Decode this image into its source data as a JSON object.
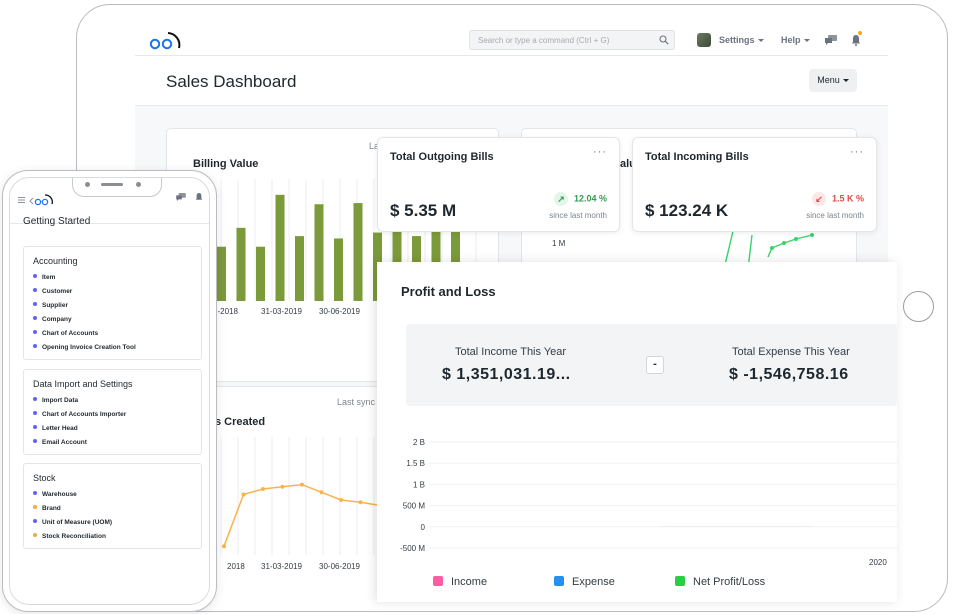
{
  "app": {
    "search_placeholder": "Search or type a command (Ctrl + G)",
    "settings_label": "Settings",
    "help_label": "Help",
    "page_title": "Sales Dashboard",
    "menu_label": "Menu"
  },
  "billing_card": {
    "title": "Billing Value",
    "sync_text": "La",
    "x_ticks": [
      "2-2018",
      "31-03-2019",
      "30-06-2019"
    ],
    "bar_color": "#7b9a3a",
    "values": [
      0.46,
      0.62,
      0.46,
      0.9,
      0.55,
      0.82,
      0.53,
      0.83,
      0.58,
      0.72,
      0.55,
      0.7,
      0.78
    ]
  },
  "second_card": {
    "title_fragment": "alu",
    "y_tick": "1 M"
  },
  "created_card": {
    "title_fragment": "s Created",
    "sync_text": "Last sync",
    "x_ticks": [
      "2018",
      "31-03-2019",
      "30-06-2019"
    ],
    "line_color": "#f8b44b",
    "values": [
      0.08,
      0.55,
      0.6,
      0.62,
      0.64,
      0.57,
      0.5,
      0.48,
      0.45,
      0.2,
      0.48
    ]
  },
  "outgoing": {
    "title": "Total Outgoing Bills",
    "value": "$ 5.35 M",
    "change": "12.04 %",
    "since": "since last month",
    "trend_color": "#2e9e4f"
  },
  "incoming": {
    "title": "Total Incoming Bills",
    "value": "$ 123.24 K",
    "change": "1.5 K %",
    "since": "since last month",
    "trend_color": "#e24c4c"
  },
  "profit_loss": {
    "title": "Profit and Loss",
    "income_label": "Total Income This Year",
    "income_value": "$ 1,351,031.19...",
    "expense_label": "Total Expense This Year",
    "expense_value": "$ -1,546,758.16",
    "operator": "-"
  },
  "chart_data": {
    "type": "bar",
    "categories": [
      "2020"
    ],
    "series": [
      {
        "name": "Income",
        "values": [
          1351031.19
        ],
        "color": "#ff5ba0"
      },
      {
        "name": "Expense",
        "values": [
          null
        ],
        "color": "#2490ef"
      },
      {
        "name": "Net Profit/Loss",
        "values": [
          null
        ],
        "color": "#29cd42"
      }
    ],
    "y_ticks": [
      "2 B",
      "1.5 B",
      "1 B",
      "500 M",
      "0",
      "-500 M"
    ],
    "ylim": [
      -500000000,
      2000000000
    ]
  },
  "phone": {
    "title": "Getting Started",
    "sections": [
      {
        "title": "Accounting",
        "items": [
          {
            "label": "Item",
            "dot": "#5e64ff"
          },
          {
            "label": "Customer",
            "dot": "#5e64ff"
          },
          {
            "label": "Supplier",
            "dot": "#5e64ff"
          },
          {
            "label": "Company",
            "dot": "#5e64ff"
          },
          {
            "label": "Chart of Accounts",
            "dot": "#5e64ff"
          },
          {
            "label": "Opening Invoice Creation Tool",
            "dot": "#5e64ff"
          }
        ]
      },
      {
        "title": "Data Import and Settings",
        "items": [
          {
            "label": "Import Data",
            "dot": "#5e64ff"
          },
          {
            "label": "Chart of Accounts Importer",
            "dot": "#5e64ff"
          },
          {
            "label": "Letter Head",
            "dot": "#5e64ff"
          },
          {
            "label": "Email Account",
            "dot": "#5e64ff"
          }
        ]
      },
      {
        "title": "Stock",
        "items": [
          {
            "label": "Warehouse",
            "dot": "#5e64ff"
          },
          {
            "label": "Brand",
            "dot": "#f8a73b"
          },
          {
            "label": "Unit of Measure (UOM)",
            "dot": "#5e64ff"
          },
          {
            "label": "Stock Reconciliation",
            "dot": "#f8a73b"
          }
        ]
      }
    ]
  }
}
